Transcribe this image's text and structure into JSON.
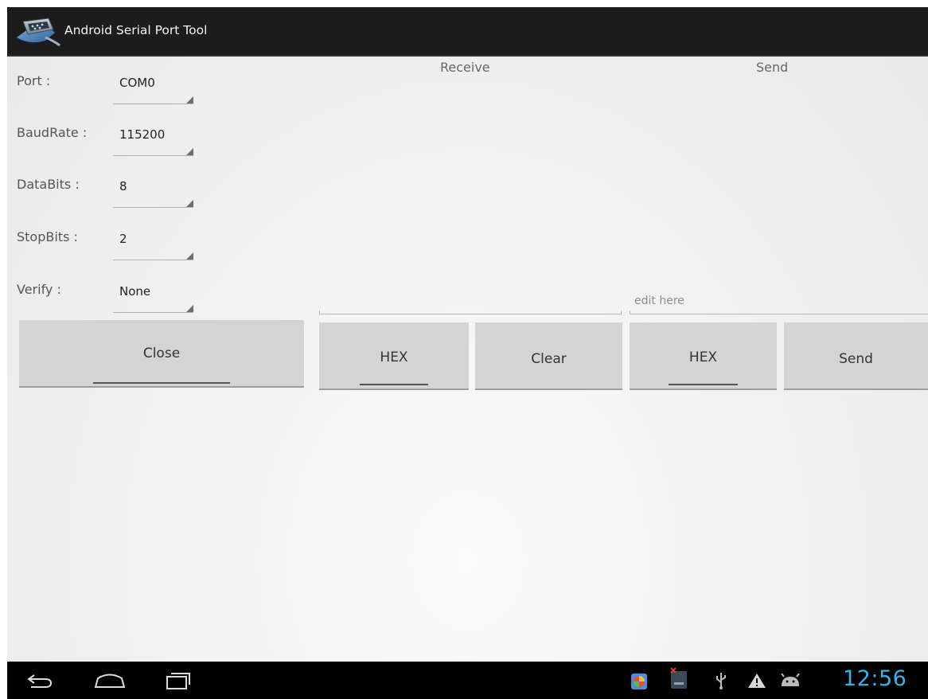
{
  "titlebar": {
    "title": "Android Serial Port Tool",
    "icon": "serial-port-app-icon"
  },
  "settings": [
    {
      "label": "Port :",
      "value": "COM0"
    },
    {
      "label": "BaudRate :",
      "value": "115200"
    },
    {
      "label": "DataBits :",
      "value": "8"
    },
    {
      "label": "StopBits :",
      "value": "2"
    },
    {
      "label": "Verify :",
      "value": "None"
    }
  ],
  "close_button": {
    "label": "Close"
  },
  "receive": {
    "header": "Receive",
    "hex_button": "HEX",
    "clear_button": "Clear"
  },
  "send": {
    "header": "Send",
    "placeholder": "edit here",
    "hex_button": "HEX",
    "send_button": "Send"
  },
  "navbar": {
    "back_icon": "back-icon",
    "home_icon": "home-icon",
    "recents_icon": "recent-apps-icon",
    "tray_icons": [
      "colorful-app-icon",
      "dark-app-icon",
      "usb-icon",
      "warning-icon",
      "android-debug-icon"
    ],
    "clock": "12:56"
  },
  "colors": {
    "titlebar_bg": "#1c1c1c",
    "button_bg": "#d4d4d4",
    "clock": "#33b5e5",
    "navbar_bg": "#000000"
  }
}
